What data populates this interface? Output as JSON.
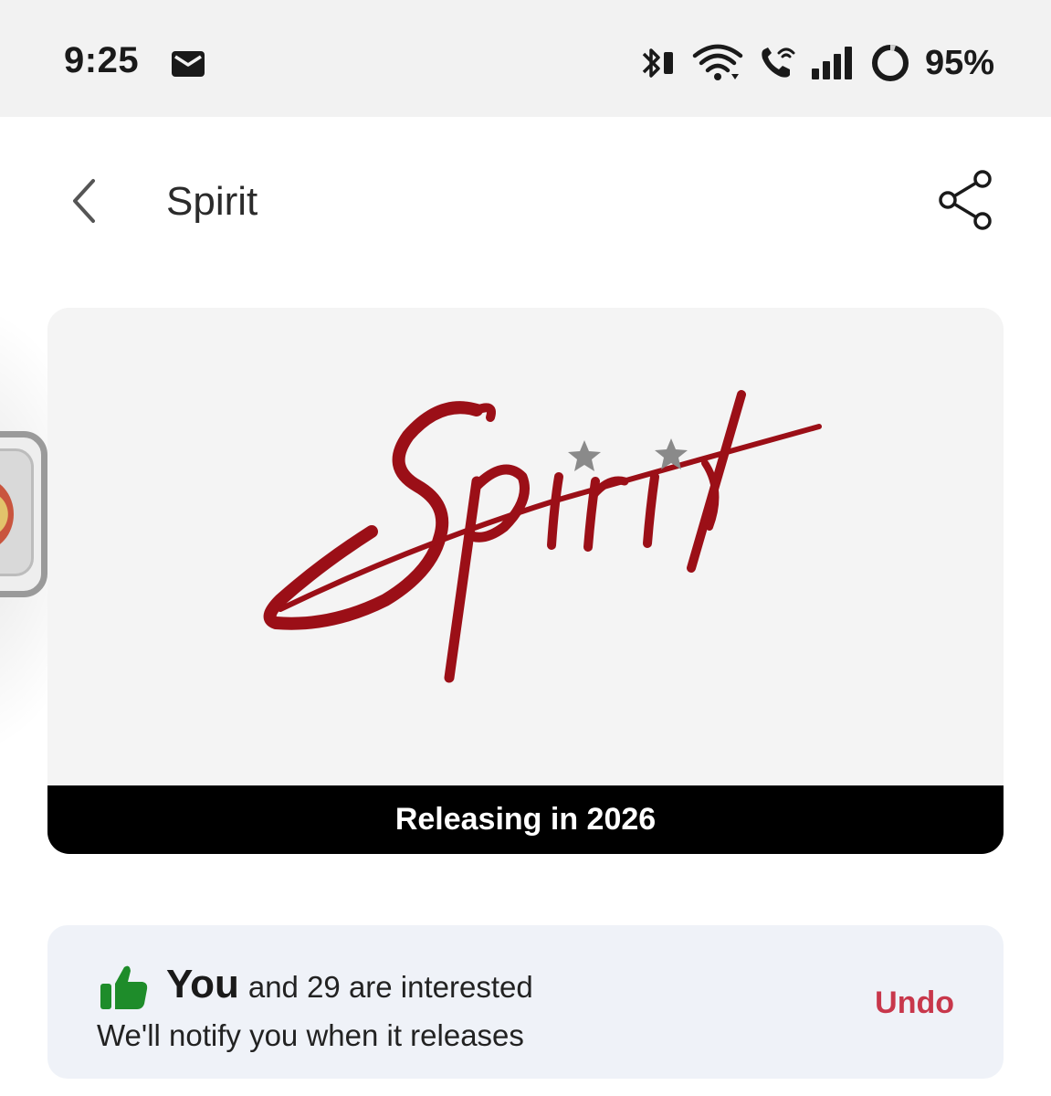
{
  "status_bar": {
    "time": "9:25",
    "battery_percent": "95%",
    "icons": [
      "mail-icon",
      "bluetooth-icon",
      "wifi-icon",
      "wifi-calling-icon",
      "signal-icon",
      "battery-ring-icon"
    ]
  },
  "header": {
    "title": "Spirit",
    "back_icon": "chevron-left-icon",
    "share_icon": "share-icon"
  },
  "poster": {
    "logo_text": "Spirit",
    "logo_color": "#9b0f17",
    "release_text": "Releasing in 2026"
  },
  "interest": {
    "you_label": "You",
    "interest_text": "and 29 are interested",
    "notify_text": "We'll notify you when it releases",
    "undo_label": "Undo",
    "thumb_color": "#1e8c2a",
    "undo_color": "#c8374b"
  }
}
